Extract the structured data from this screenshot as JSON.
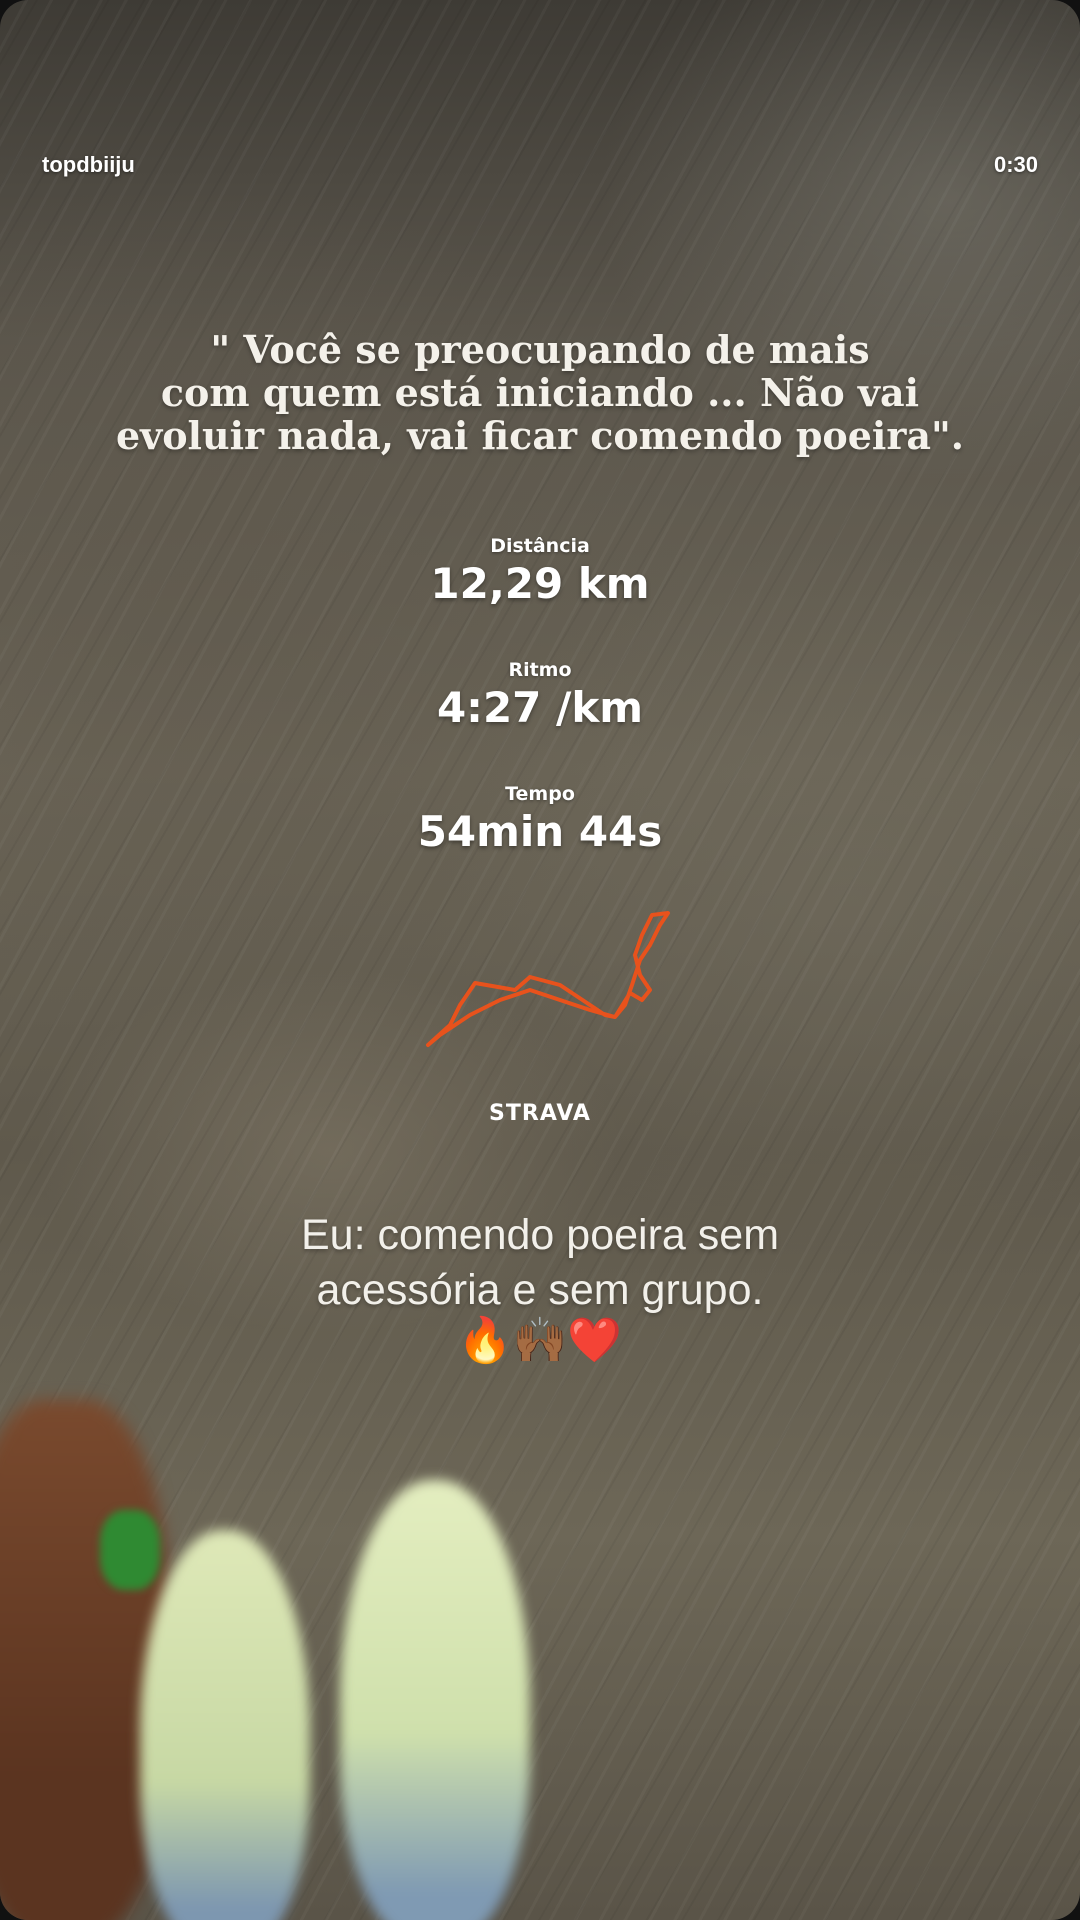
{
  "header": {
    "username": "topdbiiju",
    "timestamp": "0:30"
  },
  "quote": {
    "lines": [
      "\"  Você se preocupando de mais",
      "com quem está iniciando ... Não vai",
      "evoluir nada, vai ficar comendo poeira\"."
    ]
  },
  "stats": [
    {
      "label": "Distância",
      "value": "12,29 km"
    },
    {
      "label": "Ritmo",
      "value": "4:27 /km"
    },
    {
      "label": "Tempo",
      "value": "54min 44s"
    }
  ],
  "route": {
    "color": "#e8521c"
  },
  "brand": "STRAVA",
  "caption": {
    "lines": [
      "Eu: comendo poeira sem",
      "acessória e sem grupo."
    ],
    "emojis": "🔥🙌🏾❤️"
  }
}
